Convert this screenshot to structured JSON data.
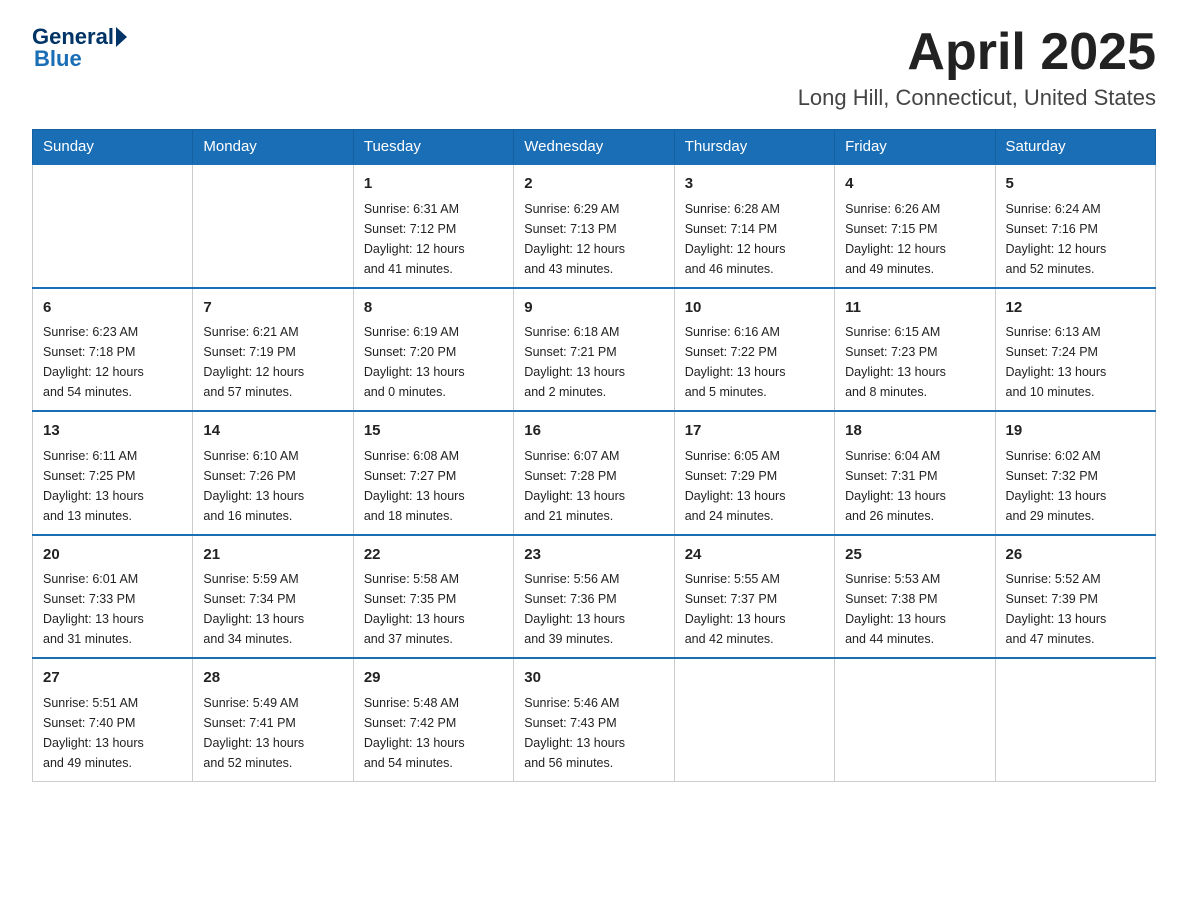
{
  "logo": {
    "general": "General",
    "blue": "Blue"
  },
  "title": "April 2025",
  "subtitle": "Long Hill, Connecticut, United States",
  "days_of_week": [
    "Sunday",
    "Monday",
    "Tuesday",
    "Wednesday",
    "Thursday",
    "Friday",
    "Saturday"
  ],
  "weeks": [
    [
      {
        "day": "",
        "info": ""
      },
      {
        "day": "",
        "info": ""
      },
      {
        "day": "1",
        "info": "Sunrise: 6:31 AM\nSunset: 7:12 PM\nDaylight: 12 hours\nand 41 minutes."
      },
      {
        "day": "2",
        "info": "Sunrise: 6:29 AM\nSunset: 7:13 PM\nDaylight: 12 hours\nand 43 minutes."
      },
      {
        "day": "3",
        "info": "Sunrise: 6:28 AM\nSunset: 7:14 PM\nDaylight: 12 hours\nand 46 minutes."
      },
      {
        "day": "4",
        "info": "Sunrise: 6:26 AM\nSunset: 7:15 PM\nDaylight: 12 hours\nand 49 minutes."
      },
      {
        "day": "5",
        "info": "Sunrise: 6:24 AM\nSunset: 7:16 PM\nDaylight: 12 hours\nand 52 minutes."
      }
    ],
    [
      {
        "day": "6",
        "info": "Sunrise: 6:23 AM\nSunset: 7:18 PM\nDaylight: 12 hours\nand 54 minutes."
      },
      {
        "day": "7",
        "info": "Sunrise: 6:21 AM\nSunset: 7:19 PM\nDaylight: 12 hours\nand 57 minutes."
      },
      {
        "day": "8",
        "info": "Sunrise: 6:19 AM\nSunset: 7:20 PM\nDaylight: 13 hours\nand 0 minutes."
      },
      {
        "day": "9",
        "info": "Sunrise: 6:18 AM\nSunset: 7:21 PM\nDaylight: 13 hours\nand 2 minutes."
      },
      {
        "day": "10",
        "info": "Sunrise: 6:16 AM\nSunset: 7:22 PM\nDaylight: 13 hours\nand 5 minutes."
      },
      {
        "day": "11",
        "info": "Sunrise: 6:15 AM\nSunset: 7:23 PM\nDaylight: 13 hours\nand 8 minutes."
      },
      {
        "day": "12",
        "info": "Sunrise: 6:13 AM\nSunset: 7:24 PM\nDaylight: 13 hours\nand 10 minutes."
      }
    ],
    [
      {
        "day": "13",
        "info": "Sunrise: 6:11 AM\nSunset: 7:25 PM\nDaylight: 13 hours\nand 13 minutes."
      },
      {
        "day": "14",
        "info": "Sunrise: 6:10 AM\nSunset: 7:26 PM\nDaylight: 13 hours\nand 16 minutes."
      },
      {
        "day": "15",
        "info": "Sunrise: 6:08 AM\nSunset: 7:27 PM\nDaylight: 13 hours\nand 18 minutes."
      },
      {
        "day": "16",
        "info": "Sunrise: 6:07 AM\nSunset: 7:28 PM\nDaylight: 13 hours\nand 21 minutes."
      },
      {
        "day": "17",
        "info": "Sunrise: 6:05 AM\nSunset: 7:29 PM\nDaylight: 13 hours\nand 24 minutes."
      },
      {
        "day": "18",
        "info": "Sunrise: 6:04 AM\nSunset: 7:31 PM\nDaylight: 13 hours\nand 26 minutes."
      },
      {
        "day": "19",
        "info": "Sunrise: 6:02 AM\nSunset: 7:32 PM\nDaylight: 13 hours\nand 29 minutes."
      }
    ],
    [
      {
        "day": "20",
        "info": "Sunrise: 6:01 AM\nSunset: 7:33 PM\nDaylight: 13 hours\nand 31 minutes."
      },
      {
        "day": "21",
        "info": "Sunrise: 5:59 AM\nSunset: 7:34 PM\nDaylight: 13 hours\nand 34 minutes."
      },
      {
        "day": "22",
        "info": "Sunrise: 5:58 AM\nSunset: 7:35 PM\nDaylight: 13 hours\nand 37 minutes."
      },
      {
        "day": "23",
        "info": "Sunrise: 5:56 AM\nSunset: 7:36 PM\nDaylight: 13 hours\nand 39 minutes."
      },
      {
        "day": "24",
        "info": "Sunrise: 5:55 AM\nSunset: 7:37 PM\nDaylight: 13 hours\nand 42 minutes."
      },
      {
        "day": "25",
        "info": "Sunrise: 5:53 AM\nSunset: 7:38 PM\nDaylight: 13 hours\nand 44 minutes."
      },
      {
        "day": "26",
        "info": "Sunrise: 5:52 AM\nSunset: 7:39 PM\nDaylight: 13 hours\nand 47 minutes."
      }
    ],
    [
      {
        "day": "27",
        "info": "Sunrise: 5:51 AM\nSunset: 7:40 PM\nDaylight: 13 hours\nand 49 minutes."
      },
      {
        "day": "28",
        "info": "Sunrise: 5:49 AM\nSunset: 7:41 PM\nDaylight: 13 hours\nand 52 minutes."
      },
      {
        "day": "29",
        "info": "Sunrise: 5:48 AM\nSunset: 7:42 PM\nDaylight: 13 hours\nand 54 minutes."
      },
      {
        "day": "30",
        "info": "Sunrise: 5:46 AM\nSunset: 7:43 PM\nDaylight: 13 hours\nand 56 minutes."
      },
      {
        "day": "",
        "info": ""
      },
      {
        "day": "",
        "info": ""
      },
      {
        "day": "",
        "info": ""
      }
    ]
  ]
}
